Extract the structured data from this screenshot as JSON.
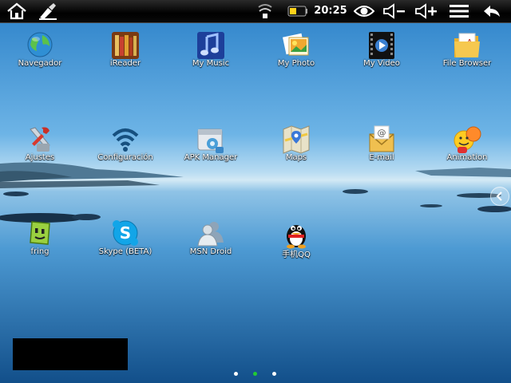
{
  "statusbar": {
    "time": "20:25"
  },
  "apps": [
    {
      "label": "Navegador",
      "icon": "globe-icon"
    },
    {
      "label": "iReader",
      "icon": "bookshelf-icon"
    },
    {
      "label": "My Music",
      "icon": "music-note-icon"
    },
    {
      "label": "My Photo",
      "icon": "photos-icon"
    },
    {
      "label": "My Video",
      "icon": "film-icon"
    },
    {
      "label": "File Browser",
      "icon": "folder-icon"
    },
    {
      "label": "Ajustes",
      "icon": "tools-icon"
    },
    {
      "label": "Configuración",
      "icon": "wifi-icon"
    },
    {
      "label": "APK Manager",
      "icon": "package-icon"
    },
    {
      "label": "Maps",
      "icon": "map-icon"
    },
    {
      "label": "E-mail",
      "icon": "envelope-icon"
    },
    {
      "label": "Animation",
      "icon": "smiley-icon"
    },
    {
      "label": "fring",
      "icon": "fring-icon"
    },
    {
      "label": "Skype (BETA)",
      "icon": "skype-icon"
    },
    {
      "label": "MSN Droid",
      "icon": "msn-buddies-icon"
    },
    {
      "label": "手机QQ",
      "icon": "penguin-icon"
    }
  ],
  "pager": {
    "pages": 3,
    "current": 2
  },
  "colors": {
    "page_dot_active": "#22cc33",
    "sky": "#5aa9e0",
    "water": "#1a5f9e"
  }
}
